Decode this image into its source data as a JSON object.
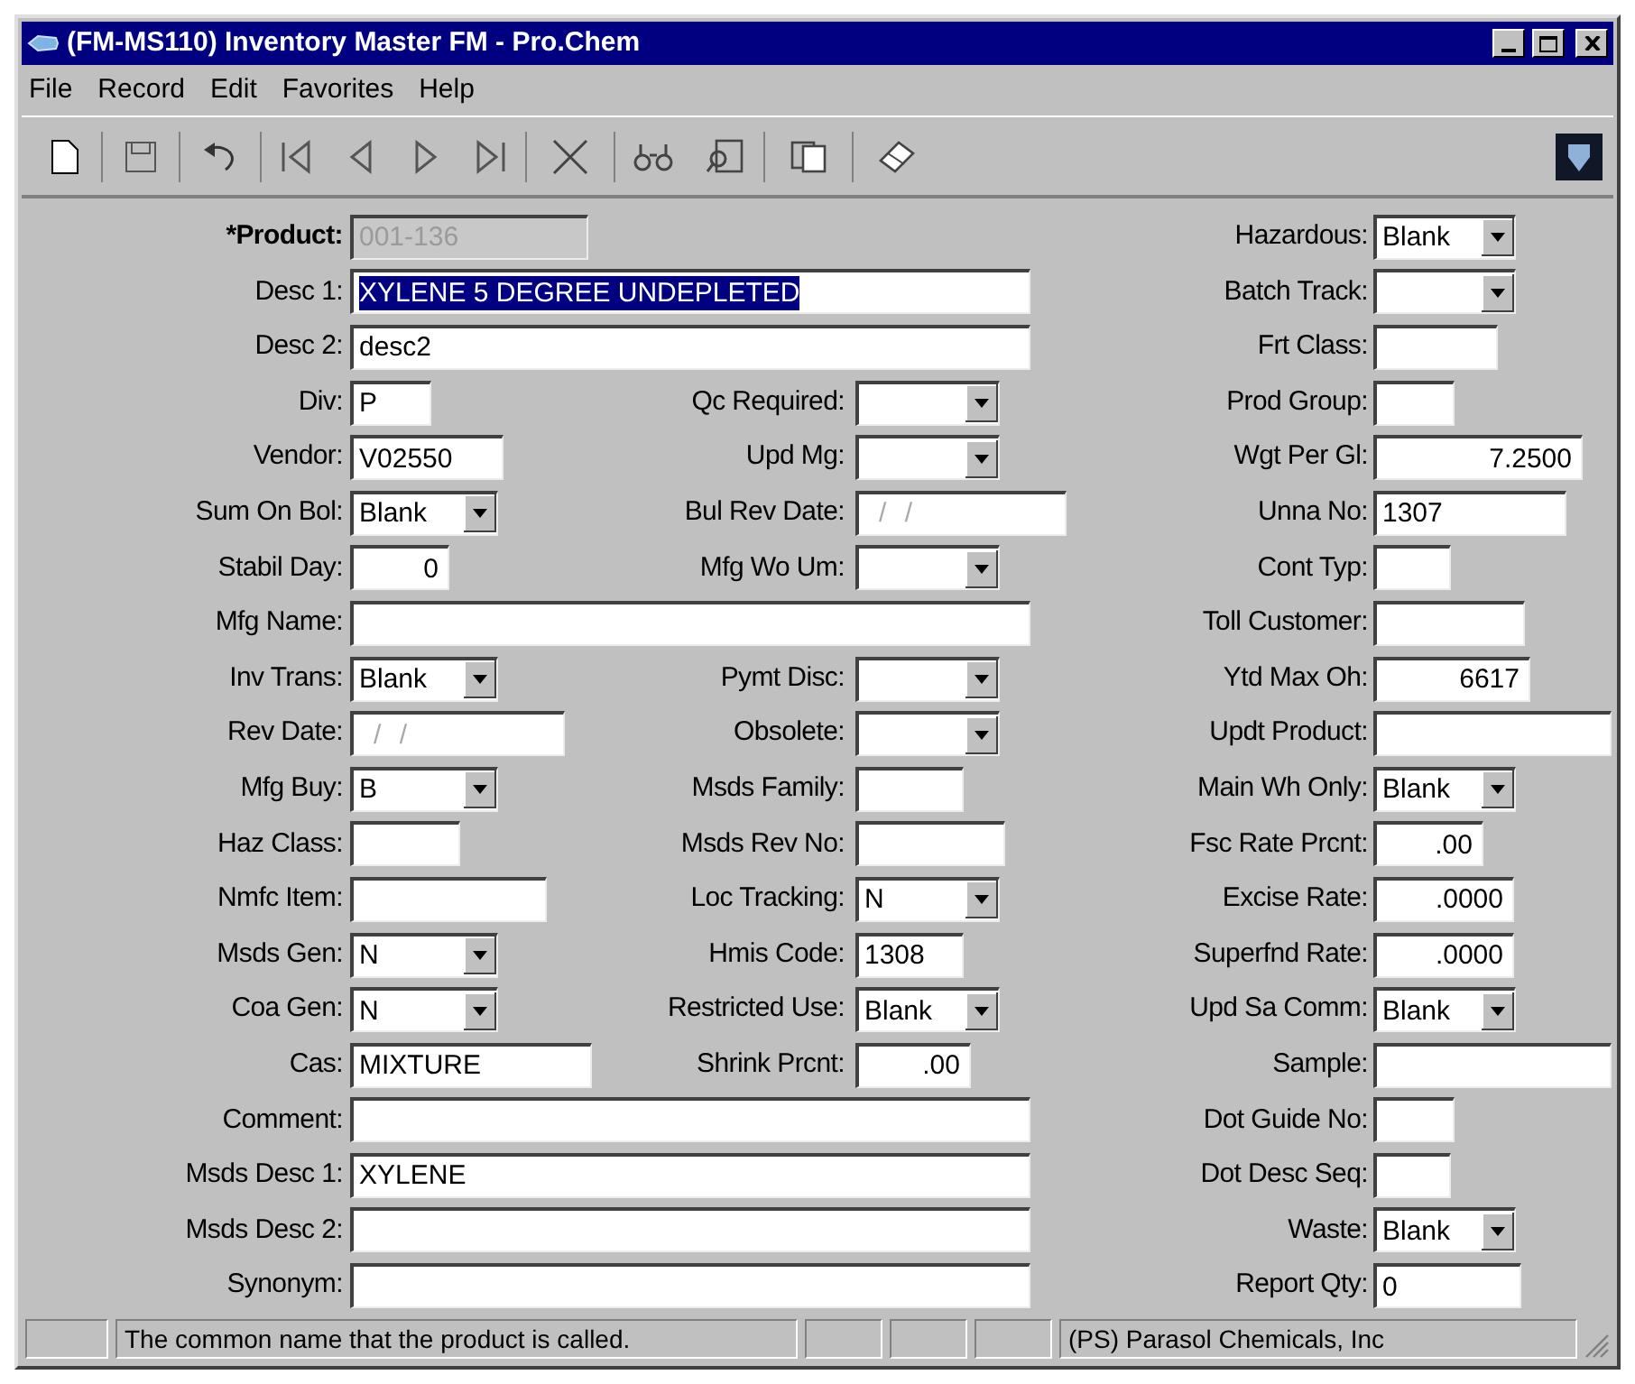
{
  "window": {
    "title": "(FM-MS110) Inventory Master FM - Pro.Chem"
  },
  "menu": [
    "File",
    "Record",
    "Edit",
    "Favorites",
    "Help"
  ],
  "form": {
    "left": [
      {
        "label": "*Product:",
        "kind": "text",
        "value": "001-136",
        "disabled": true,
        "required": true,
        "highlighted": false
      },
      {
        "label": "Desc 1:",
        "kind": "text",
        "value": "XYLENE 5 DEGREE UNDEPLETED",
        "disabled": false,
        "required": false,
        "highlighted": true
      },
      {
        "label": "Desc 2:",
        "kind": "text",
        "value": "desc2",
        "disabled": false,
        "required": false,
        "highlighted": false
      },
      {
        "label": "Div:",
        "kind": "text",
        "value": "P",
        "disabled": false,
        "required": false,
        "highlighted": false
      },
      {
        "label": "Vendor:",
        "kind": "text",
        "value": "V02550",
        "disabled": false,
        "required": false,
        "highlighted": false
      },
      {
        "label": "Sum On Bol:",
        "kind": "combo",
        "value": "Blank",
        "disabled": false,
        "required": false,
        "highlighted": false
      },
      {
        "label": "Stabil Day:",
        "kind": "number",
        "value": "0",
        "disabled": false,
        "required": false,
        "highlighted": false
      },
      {
        "label": "Mfg Name:",
        "kind": "text",
        "disabled": false,
        "required": false,
        "highlighted": false
      },
      {
        "label": "Inv Trans:",
        "kind": "combo",
        "value": "Blank",
        "disabled": false,
        "required": false,
        "highlighted": false
      },
      {
        "label": "Rev Date:",
        "kind": "date",
        "placeholder": "/ /",
        "disabled": false,
        "required": false,
        "highlighted": false
      },
      {
        "label": "Mfg Buy:",
        "kind": "combo",
        "value": "B",
        "disabled": false,
        "required": false,
        "highlighted": false
      },
      {
        "label": "Haz Class:",
        "kind": "text",
        "disabled": false,
        "required": false,
        "highlighted": false
      },
      {
        "label": "Nmfc Item:",
        "kind": "text",
        "disabled": false,
        "required": false,
        "highlighted": false
      },
      {
        "label": "Msds Gen:",
        "kind": "combo",
        "value": "N",
        "disabled": false,
        "required": false,
        "highlighted": false
      },
      {
        "label": "Coa Gen:",
        "kind": "combo",
        "value": "N",
        "disabled": false,
        "required": false,
        "highlighted": false
      },
      {
        "label": "Cas:",
        "kind": "text",
        "value": "MIXTURE",
        "disabled": false,
        "required": false,
        "highlighted": false
      },
      {
        "label": "Comment:",
        "kind": "text",
        "disabled": false,
        "required": false,
        "highlighted": false
      },
      {
        "label": "Msds Desc 1:",
        "kind": "text",
        "value": "XYLENE",
        "disabled": false,
        "required": false,
        "highlighted": false
      },
      {
        "label": "Msds Desc 2:",
        "kind": "text",
        "disabled": false,
        "required": false,
        "highlighted": false
      },
      {
        "label": "Synonym:",
        "kind": "text",
        "disabled": false,
        "required": false,
        "highlighted": false
      }
    ],
    "middle": [
      {
        "label": "Qc Required:",
        "kind": "combo",
        "disabled": false,
        "required": false,
        "highlighted": false
      },
      {
        "label": "Upd Mg:",
        "kind": "combo",
        "disabled": false,
        "required": false,
        "highlighted": false
      },
      {
        "label": "Bul Rev Date:",
        "kind": "date",
        "placeholder": "/ /",
        "disabled": false,
        "required": false,
        "highlighted": false
      },
      {
        "label": "Mfg Wo Um:",
        "kind": "combo",
        "disabled": false,
        "required": false,
        "highlighted": false
      },
      {
        "label": "Pymt Disc:",
        "kind": "combo",
        "disabled": false,
        "required": false,
        "highlighted": false
      },
      {
        "label": "Obsolete:",
        "kind": "combo",
        "disabled": false,
        "required": false,
        "highlighted": false
      },
      {
        "label": "Msds Family:",
        "kind": "text",
        "disabled": false,
        "required": false,
        "highlighted": false
      },
      {
        "label": "Msds Rev No:",
        "kind": "text",
        "disabled": false,
        "required": false,
        "highlighted": false
      },
      {
        "label": "Loc Tracking:",
        "kind": "combo",
        "value": "N",
        "disabled": false,
        "required": false,
        "highlighted": false
      },
      {
        "label": "Hmis Code:",
        "kind": "text",
        "value": "1308",
        "disabled": false,
        "required": false,
        "highlighted": false
      },
      {
        "label": "Restricted Use:",
        "kind": "combo",
        "value": "Blank",
        "disabled": false,
        "required": false,
        "highlighted": false
      },
      {
        "label": "Shrink Prcnt:",
        "kind": "number",
        "value": ".00",
        "disabled": false,
        "required": false,
        "highlighted": false
      }
    ],
    "right": [
      {
        "label": "Hazardous:",
        "kind": "combo",
        "value": "Blank",
        "disabled": false,
        "required": false,
        "highlighted": false
      },
      {
        "label": "Batch Track:",
        "kind": "combo",
        "disabled": false,
        "required": false,
        "highlighted": false
      },
      {
        "label": "Frt Class:",
        "kind": "text",
        "disabled": false,
        "required": false,
        "highlighted": false
      },
      {
        "label": "Prod Group:",
        "kind": "text",
        "disabled": false,
        "required": false,
        "highlighted": false
      },
      {
        "label": "Wgt Per Gl:",
        "kind": "number",
        "value": "7.2500",
        "disabled": false,
        "required": false,
        "highlighted": false
      },
      {
        "label": "Unna No:",
        "kind": "text",
        "value": "1307",
        "disabled": false,
        "required": false,
        "highlighted": false
      },
      {
        "label": "Cont Typ:",
        "kind": "text",
        "disabled": false,
        "required": false,
        "highlighted": false
      },
      {
        "label": "Toll Customer:",
        "kind": "text",
        "disabled": false,
        "required": false,
        "highlighted": false
      },
      {
        "label": "Ytd Max Oh:",
        "kind": "number",
        "value": "6617",
        "disabled": false,
        "required": false,
        "highlighted": false
      },
      {
        "label": "Updt Product:",
        "kind": "text",
        "disabled": false,
        "required": false,
        "highlighted": false
      },
      {
        "label": "Main Wh Only:",
        "kind": "combo",
        "value": "Blank",
        "disabled": false,
        "required": false,
        "highlighted": false
      },
      {
        "label": "Fsc Rate Prcnt:",
        "kind": "number",
        "value": ".00",
        "disabled": false,
        "required": false,
        "highlighted": false
      },
      {
        "label": "Excise Rate:",
        "kind": "number",
        "value": ".0000",
        "disabled": false,
        "required": false,
        "highlighted": false
      },
      {
        "label": "Superfnd Rate:",
        "kind": "number",
        "value": ".0000",
        "disabled": false,
        "required": false,
        "highlighted": false
      },
      {
        "label": "Upd Sa Comm:",
        "kind": "combo",
        "value": "Blank",
        "disabled": false,
        "required": false,
        "highlighted": false
      },
      {
        "label": "Sample:",
        "kind": "text",
        "disabled": false,
        "required": false,
        "highlighted": false
      },
      {
        "label": "Dot Guide No:",
        "kind": "text",
        "disabled": false,
        "required": false,
        "highlighted": false
      },
      {
        "label": "Dot Desc Seq:",
        "kind": "text",
        "disabled": false,
        "required": false,
        "highlighted": false
      },
      {
        "label": "Waste:",
        "kind": "combo",
        "value": "Blank",
        "disabled": false,
        "required": false,
        "highlighted": false
      },
      {
        "label": "Report Qty:",
        "kind": "text",
        "value": "0",
        "disabled": false,
        "required": false,
        "highlighted": false
      }
    ]
  },
  "status_bar": {
    "message": "The common name that the product is called.",
    "company": "(PS) Parasol Chemicals, Inc"
  }
}
